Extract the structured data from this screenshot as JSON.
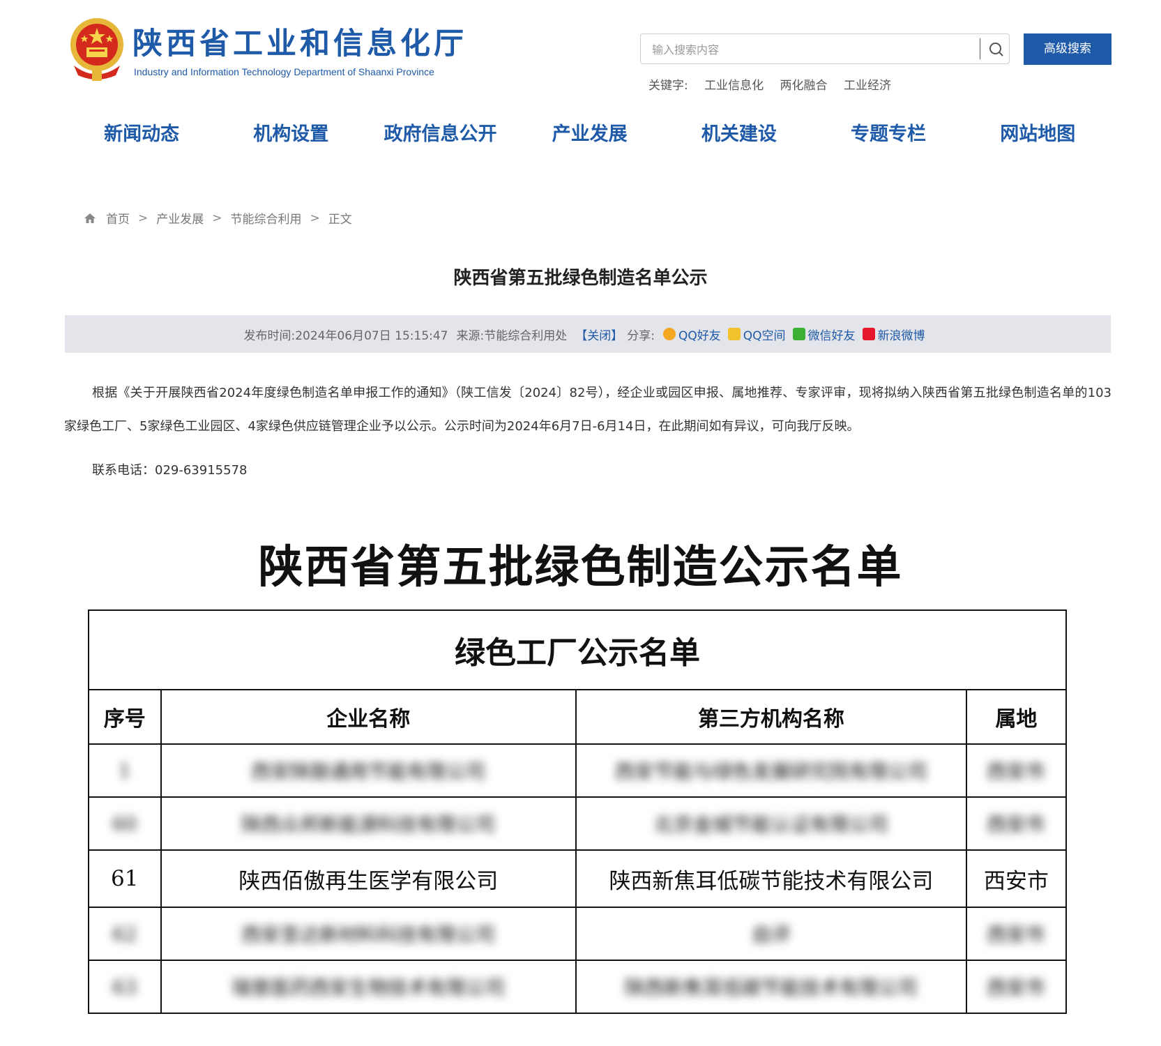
{
  "header": {
    "site_title": "陕西省工业和信息化厅",
    "site_subtitle": "Industry and Information Technology Department of Shaanxi Province",
    "search_placeholder": "输入搜索内容",
    "advanced_search_label": "高级搜索",
    "keywords_label": "关键字:",
    "keywords": [
      "工业信息化",
      "两化融合",
      "工业经济"
    ]
  },
  "nav": [
    "新闻动态",
    "机构设置",
    "政府信息公开",
    "产业发展",
    "机关建设",
    "专题专栏",
    "网站地图"
  ],
  "breadcrumb": [
    "首页",
    "产业发展",
    "节能综合利用",
    "正文"
  ],
  "breadcrumb_sep": ">",
  "article": {
    "title": "陕西省第五批绿色制造名单公示",
    "publish_label": "发布时间:",
    "publish_time": "2024年06月07日 15:15:47",
    "source_label": "来源:",
    "source": "节能综合利用处",
    "close_label": "【关闭】",
    "share_label": "分享:",
    "share": [
      "QQ好友",
      "QQ空间",
      "微信好友",
      "新浪微博"
    ],
    "paragraph": "根据《关于开展陕西省2024年度绿色制造名单申报工作的通知》（陕工信发〔2024〕82号），经企业或园区申报、属地推荐、专家评审，现将拟纳入陕西省第五批绿色制造名单的103家绿色工厂、5家绿色工业园区、4家绿色供应链管理企业予以公示。公示时间为2024年6月7日-6月14日，在此期间如有异议，可向我厅反映。",
    "contact": "联系电话：029-63915578"
  },
  "document": {
    "title": "陕西省第五批绿色制造公示名单",
    "table_caption": "绿色工厂公示名单",
    "columns": [
      "序号",
      "企业名称",
      "第三方机构名称",
      "属地"
    ],
    "rows": [
      {
        "no": "1",
        "company": "西安陕鼓通用节能有限公司",
        "agency": "西安节能与绿色发展研究院有限公司",
        "region": "西安市",
        "blurred": true
      },
      {
        "no": "60",
        "company": "陕西众邦新能源科技有限公司",
        "agency": "北京金城节能认证有限公司",
        "region": "西安市",
        "blurred": true
      },
      {
        "no": "61",
        "company": "陕西佰傲再生医学有限公司",
        "agency": "陕西新焦耳低碳节能技术有限公司",
        "region": "西安市",
        "blurred": false
      },
      {
        "no": "62",
        "company": "西安圣达新材料科技有限公司",
        "agency": "自评",
        "region": "西安市",
        "blurred": true
      },
      {
        "no": "63",
        "company": "瑞普医药西安生物技术有限公司",
        "agency": "陕西新焦耳低碳节能技术有限公司",
        "region": "西安市",
        "blurred": true
      }
    ]
  }
}
